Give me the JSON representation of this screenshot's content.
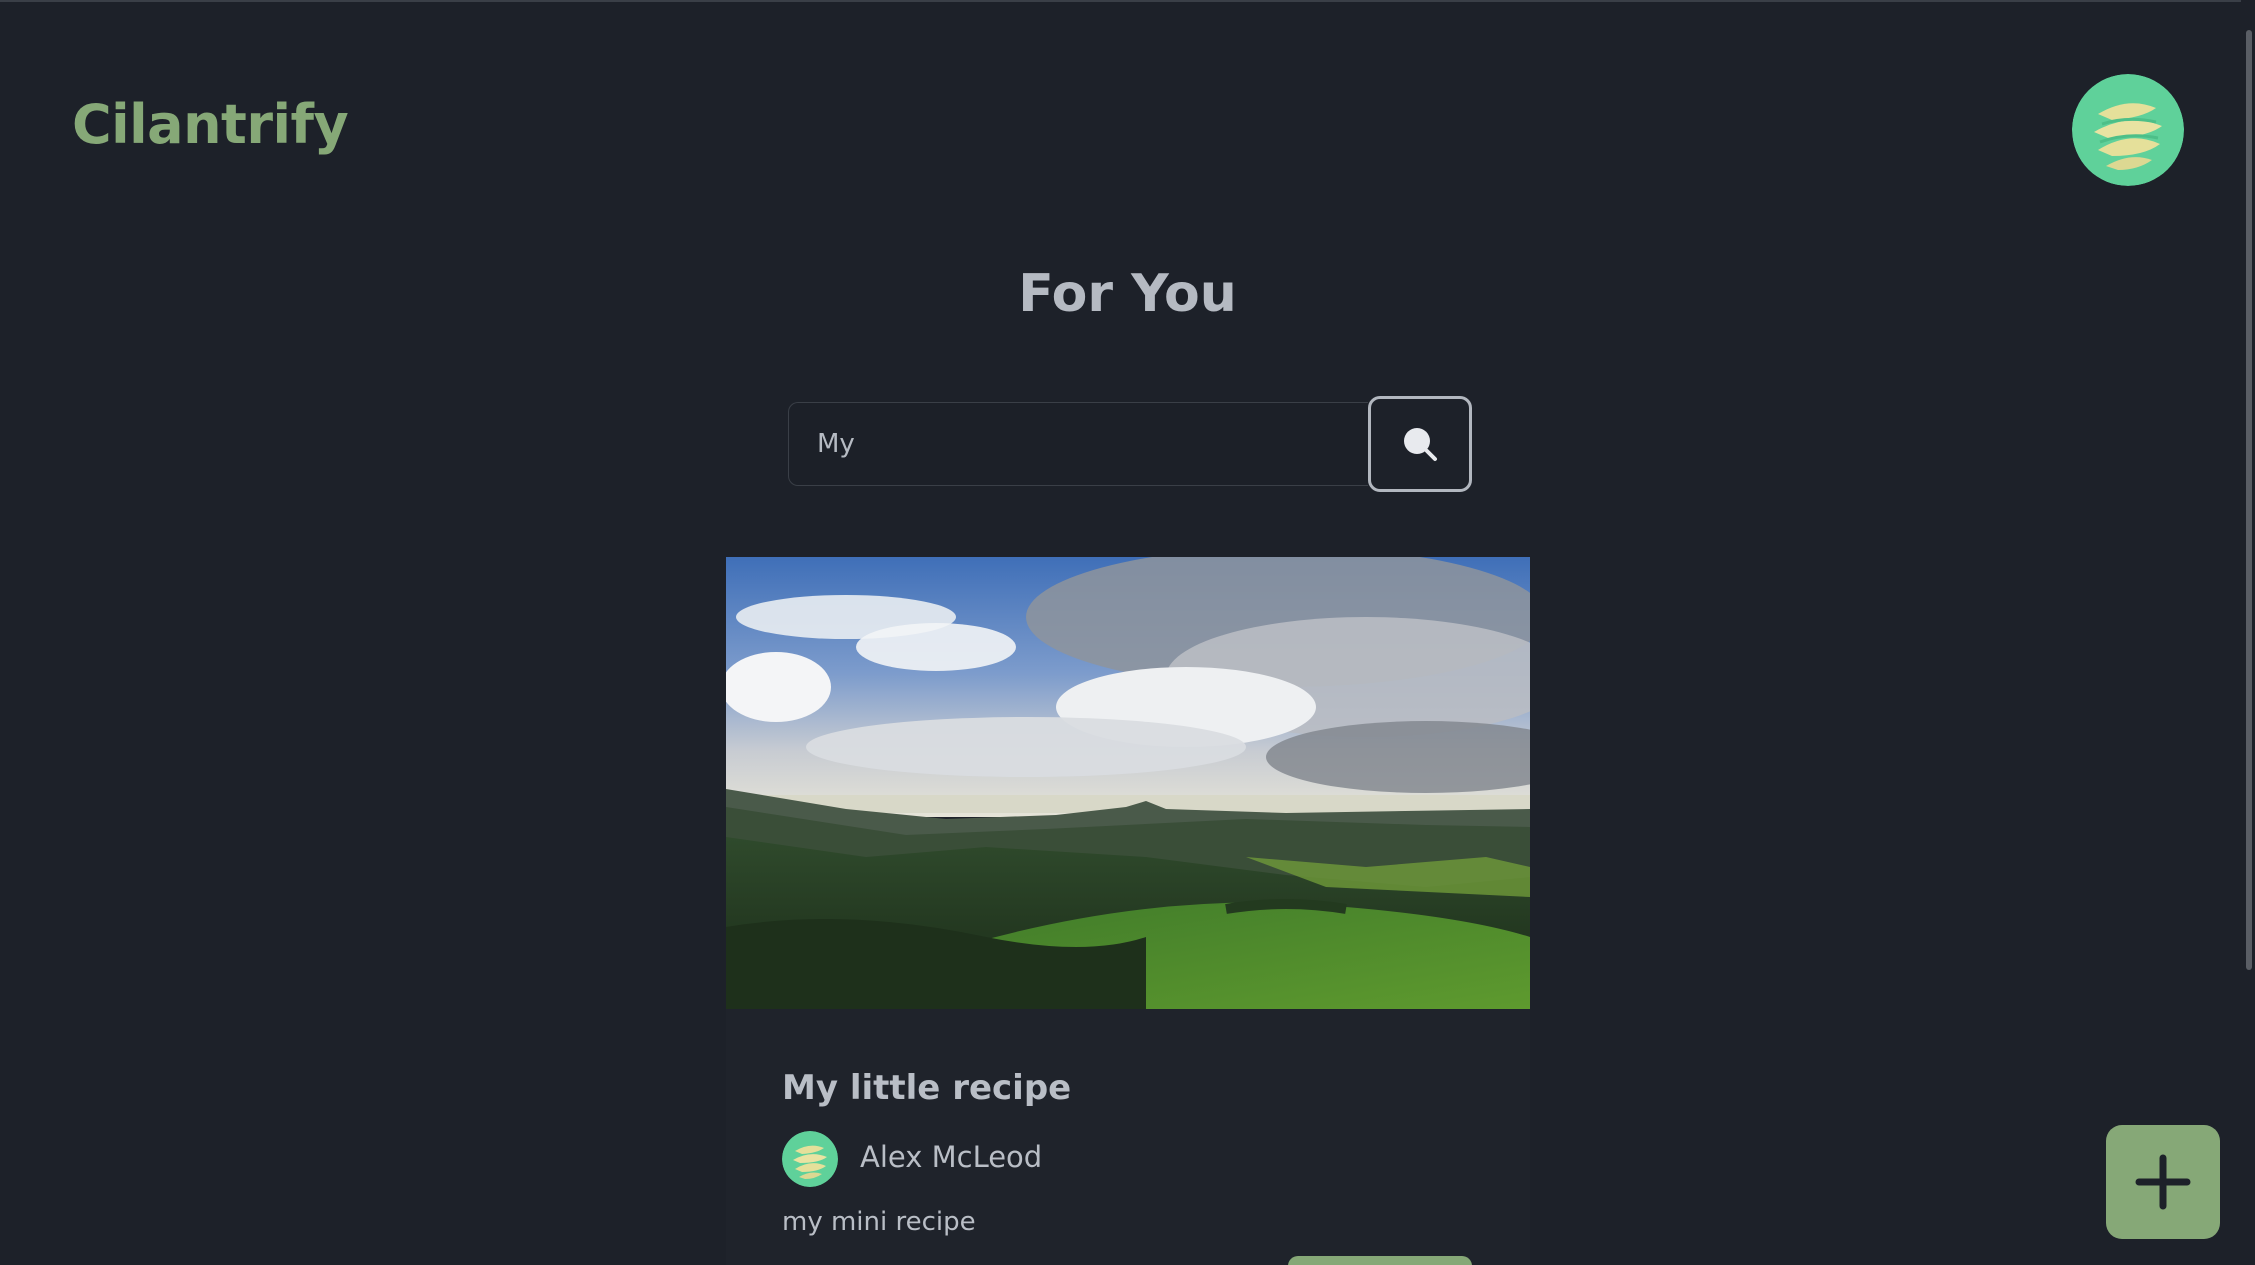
{
  "header": {
    "logo": "Cilantrify"
  },
  "main": {
    "title": "For You"
  },
  "search": {
    "value": "My",
    "icon": "search-icon"
  },
  "recipes": [
    {
      "title": "My little recipe",
      "author": "Alex McLeod",
      "description": "my mini recipe",
      "image": "landscape-photo"
    }
  ],
  "fab": {
    "icon": "plus-icon"
  },
  "colors": {
    "background": "#1d2129",
    "brand": "#86a877",
    "text": "#b9bec6"
  }
}
